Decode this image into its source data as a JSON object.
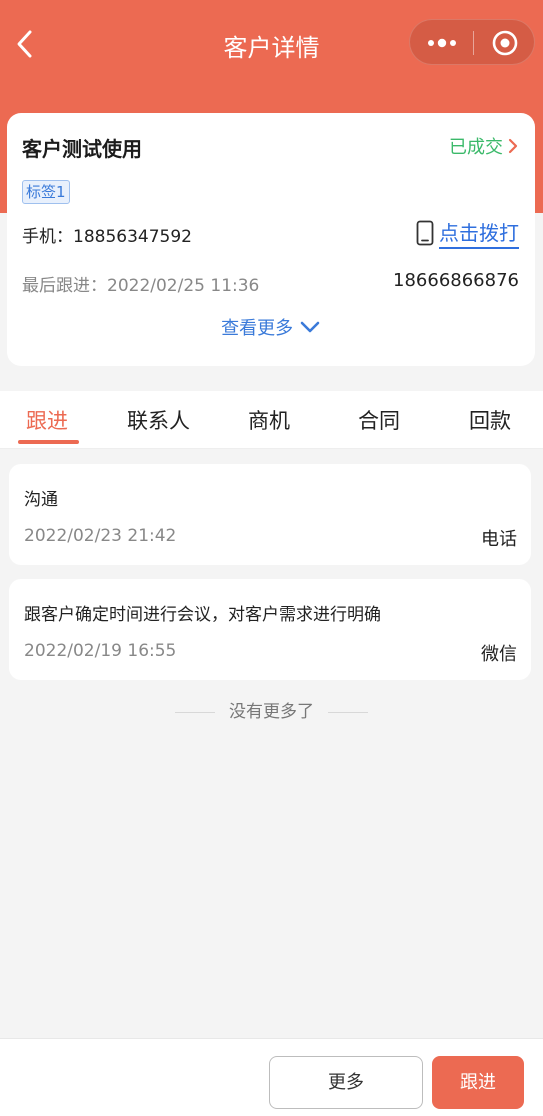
{
  "nav": {
    "title": "客户详情"
  },
  "customer": {
    "name": "客户测试使用",
    "status": "已成交",
    "tag": "标签1",
    "phone_label": "手机：",
    "phone": "18856347592",
    "dial_label": "点击拨打",
    "last_follow_label": "最后跟进：",
    "last_follow_time": "2022/02/25 11:36",
    "other_phone": "18666866876",
    "see_more": "查看更多"
  },
  "tabs": [
    {
      "label": "跟进",
      "active": true
    },
    {
      "label": "联系人",
      "active": false
    },
    {
      "label": "商机",
      "active": false
    },
    {
      "label": "合同",
      "active": false
    },
    {
      "label": "回款",
      "active": false
    }
  ],
  "records": [
    {
      "content": "沟通",
      "time": "2022/02/23 21:42",
      "type": "电话"
    },
    {
      "content": "跟客户确定时间进行会议，对客户需求进行明确",
      "time": "2022/02/19 16:55",
      "type": "微信"
    }
  ],
  "no_more": "没有更多了",
  "actions": {
    "more": "更多",
    "follow": "跟进"
  },
  "colors": {
    "brand": "#ec6a52",
    "status_green": "#3bb96a",
    "link_blue": "#2f6fde"
  }
}
